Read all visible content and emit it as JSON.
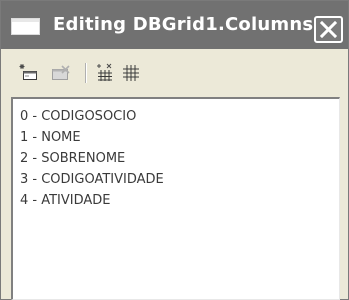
{
  "window": {
    "title": "Editing DBGrid1.Columns",
    "close_icon": "close-icon"
  },
  "toolbar": {
    "buttons": [
      {
        "name": "add-new-icon",
        "enabled": true
      },
      {
        "name": "delete-icon",
        "enabled": false
      },
      {
        "name": "add-all-fields-icon",
        "enabled": true
      },
      {
        "name": "restore-defaults-icon",
        "enabled": true
      }
    ]
  },
  "columns": {
    "items": [
      "0 - CODIGOSOCIO",
      "1 - NOME",
      "2 - SOBRENOME",
      "3 - CODIGOATIVIDADE",
      "4 - ATIVIDADE"
    ]
  }
}
